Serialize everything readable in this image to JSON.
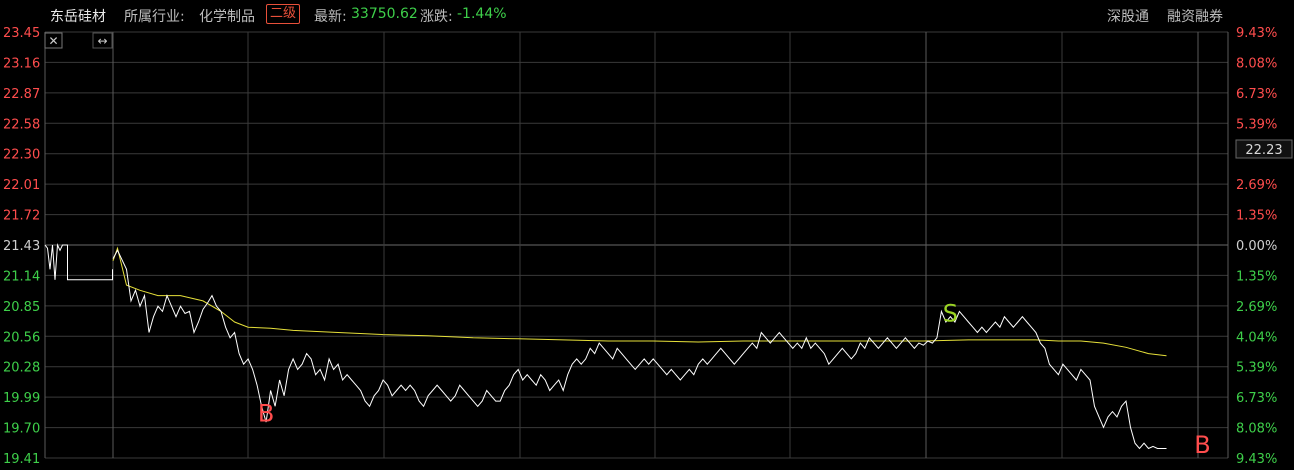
{
  "header": {
    "stock_name": "东岳硅材",
    "industry_label": "所属行业:",
    "industry_name": "化学制品",
    "level_badge": "二级",
    "latest_label": "最新:",
    "latest_value": "33750.62",
    "change_label": "涨跌:",
    "change_value": "-1.44%",
    "link_shenzhen": "深股通",
    "link_margin": "融资融券"
  },
  "controls": {
    "close_glyph": "✕",
    "resize_glyph": "↔"
  },
  "colors": {
    "up": "#ff4d4d",
    "down": "#3ecf4a",
    "neutral": "#cfcfcf",
    "price_line": "#ffffff",
    "avg_line": "#e6e03a",
    "grid": "#3a3a3a"
  },
  "chart_data": {
    "type": "line",
    "y_ticks": [
      "23.45",
      "23.16",
      "22.87",
      "22.58",
      "22.30",
      "22.01",
      "21.72",
      "21.43",
      "21.14",
      "20.85",
      "20.56",
      "20.28",
      "19.99",
      "19.70",
      "19.41"
    ],
    "pct_ticks": [
      "9.43%",
      "8.08%",
      "6.73%",
      "5.39%",
      "4.04%",
      "2.69%",
      "1.35%",
      "0.00%",
      "1.35%",
      "2.69%",
      "4.04%",
      "5.39%",
      "6.73%",
      "8.08%",
      "9.43%"
    ],
    "ylim": [
      19.41,
      23.45
    ],
    "prev_close": 21.43,
    "current_price_label": "22.23",
    "x_range": [
      0,
      241
    ],
    "pre_segment": [
      [
        0,
        21.43
      ],
      [
        1,
        21.4
      ],
      [
        2,
        21.2
      ],
      [
        3,
        21.43
      ],
      [
        4,
        21.1
      ],
      [
        5,
        21.43
      ],
      [
        6,
        21.38
      ],
      [
        7,
        21.43
      ],
      [
        8,
        21.43
      ],
      [
        9,
        21.43
      ],
      [
        9,
        21.1
      ],
      [
        27,
        21.1
      ],
      [
        27,
        21.2
      ]
    ],
    "price": [
      [
        0,
        21.3
      ],
      [
        1,
        21.38
      ],
      [
        3,
        21.2
      ],
      [
        4,
        20.9
      ],
      [
        5,
        21.0
      ],
      [
        6,
        20.85
      ],
      [
        7,
        20.95
      ],
      [
        8,
        20.6
      ],
      [
        9,
        20.75
      ],
      [
        10,
        20.85
      ],
      [
        11,
        20.8
      ],
      [
        12,
        20.95
      ],
      [
        13,
        20.85
      ],
      [
        14,
        20.75
      ],
      [
        15,
        20.85
      ],
      [
        16,
        20.78
      ],
      [
        17,
        20.8
      ],
      [
        18,
        20.6
      ],
      [
        19,
        20.7
      ],
      [
        20,
        20.82
      ],
      [
        21,
        20.88
      ],
      [
        22,
        20.95
      ],
      [
        23,
        20.85
      ],
      [
        24,
        20.8
      ],
      [
        25,
        20.65
      ],
      [
        26,
        20.55
      ],
      [
        27,
        20.6
      ],
      [
        28,
        20.4
      ],
      [
        29,
        20.3
      ],
      [
        30,
        20.35
      ],
      [
        31,
        20.25
      ],
      [
        32,
        20.1
      ],
      [
        33,
        19.9
      ],
      [
        34,
        19.75
      ],
      [
        35,
        20.05
      ],
      [
        36,
        19.9
      ],
      [
        37,
        20.15
      ],
      [
        38,
        20.0
      ],
      [
        39,
        20.25
      ],
      [
        40,
        20.35
      ],
      [
        41,
        20.25
      ],
      [
        42,
        20.3
      ],
      [
        43,
        20.4
      ],
      [
        44,
        20.35
      ],
      [
        45,
        20.2
      ],
      [
        46,
        20.25
      ],
      [
        47,
        20.15
      ],
      [
        48,
        20.35
      ],
      [
        49,
        20.25
      ],
      [
        50,
        20.3
      ],
      [
        51,
        20.15
      ],
      [
        52,
        20.2
      ],
      [
        53,
        20.15
      ],
      [
        54,
        20.1
      ],
      [
        55,
        20.05
      ],
      [
        56,
        19.95
      ],
      [
        57,
        19.9
      ],
      [
        58,
        20.0
      ],
      [
        59,
        20.05
      ],
      [
        60,
        20.15
      ],
      [
        61,
        20.1
      ],
      [
        62,
        20.0
      ],
      [
        63,
        20.05
      ],
      [
        64,
        20.1
      ],
      [
        65,
        20.05
      ],
      [
        66,
        20.1
      ],
      [
        67,
        20.05
      ],
      [
        68,
        19.95
      ],
      [
        69,
        19.9
      ],
      [
        70,
        20.0
      ],
      [
        71,
        20.05
      ],
      [
        72,
        20.1
      ],
      [
        73,
        20.05
      ],
      [
        74,
        20.0
      ],
      [
        75,
        19.95
      ],
      [
        76,
        20.0
      ],
      [
        77,
        20.1
      ],
      [
        78,
        20.05
      ],
      [
        79,
        20.0
      ],
      [
        80,
        19.95
      ],
      [
        81,
        19.9
      ],
      [
        82,
        19.95
      ],
      [
        83,
        20.05
      ],
      [
        84,
        20.0
      ],
      [
        85,
        19.95
      ],
      [
        86,
        19.95
      ],
      [
        87,
        20.05
      ],
      [
        88,
        20.1
      ],
      [
        89,
        20.2
      ],
      [
        90,
        20.25
      ],
      [
        91,
        20.15
      ],
      [
        92,
        20.2
      ],
      [
        93,
        20.15
      ],
      [
        94,
        20.1
      ],
      [
        95,
        20.2
      ],
      [
        96,
        20.15
      ],
      [
        97,
        20.05
      ],
      [
        98,
        20.1
      ],
      [
        99,
        20.15
      ],
      [
        100,
        20.05
      ],
      [
        101,
        20.2
      ],
      [
        102,
        20.3
      ],
      [
        103,
        20.35
      ],
      [
        104,
        20.3
      ],
      [
        105,
        20.35
      ],
      [
        106,
        20.45
      ],
      [
        107,
        20.4
      ],
      [
        108,
        20.5
      ],
      [
        109,
        20.45
      ],
      [
        110,
        20.4
      ],
      [
        111,
        20.35
      ],
      [
        112,
        20.45
      ],
      [
        113,
        20.4
      ],
      [
        114,
        20.35
      ],
      [
        115,
        20.3
      ],
      [
        116,
        20.25
      ],
      [
        117,
        20.3
      ],
      [
        118,
        20.35
      ],
      [
        119,
        20.3
      ],
      [
        120,
        20.35
      ],
      [
        121,
        20.3
      ],
      [
        122,
        20.25
      ],
      [
        123,
        20.2
      ],
      [
        124,
        20.25
      ],
      [
        125,
        20.2
      ],
      [
        126,
        20.15
      ],
      [
        127,
        20.2
      ],
      [
        128,
        20.25
      ],
      [
        129,
        20.2
      ],
      [
        130,
        20.3
      ],
      [
        131,
        20.35
      ],
      [
        132,
        20.3
      ],
      [
        133,
        20.35
      ],
      [
        134,
        20.4
      ],
      [
        135,
        20.45
      ],
      [
        136,
        20.4
      ],
      [
        137,
        20.35
      ],
      [
        138,
        20.3
      ],
      [
        139,
        20.35
      ],
      [
        140,
        20.4
      ],
      [
        141,
        20.45
      ],
      [
        142,
        20.5
      ],
      [
        143,
        20.45
      ],
      [
        144,
        20.6
      ],
      [
        145,
        20.55
      ],
      [
        146,
        20.5
      ],
      [
        147,
        20.55
      ],
      [
        148,
        20.6
      ],
      [
        149,
        20.55
      ],
      [
        150,
        20.5
      ],
      [
        151,
        20.45
      ],
      [
        152,
        20.5
      ],
      [
        153,
        20.45
      ],
      [
        154,
        20.55
      ],
      [
        155,
        20.45
      ],
      [
        156,
        20.5
      ],
      [
        157,
        20.45
      ],
      [
        158,
        20.4
      ],
      [
        159,
        20.3
      ],
      [
        160,
        20.35
      ],
      [
        161,
        20.4
      ],
      [
        162,
        20.45
      ],
      [
        163,
        20.4
      ],
      [
        164,
        20.35
      ],
      [
        165,
        20.4
      ],
      [
        166,
        20.5
      ],
      [
        167,
        20.45
      ],
      [
        168,
        20.55
      ],
      [
        169,
        20.5
      ],
      [
        170,
        20.45
      ],
      [
        171,
        20.5
      ],
      [
        172,
        20.55
      ],
      [
        173,
        20.5
      ],
      [
        174,
        20.45
      ],
      [
        175,
        20.5
      ],
      [
        176,
        20.55
      ],
      [
        177,
        20.5
      ],
      [
        178,
        20.45
      ],
      [
        179,
        20.5
      ],
      [
        180,
        20.48
      ],
      [
        181,
        20.52
      ],
      [
        182,
        20.5
      ],
      [
        183,
        20.55
      ],
      [
        184,
        20.8
      ],
      [
        185,
        20.7
      ],
      [
        186,
        20.75
      ],
      [
        187,
        20.7
      ],
      [
        188,
        20.8
      ],
      [
        189,
        20.75
      ],
      [
        190,
        20.7
      ],
      [
        191,
        20.65
      ],
      [
        192,
        20.6
      ],
      [
        193,
        20.65
      ],
      [
        194,
        20.6
      ],
      [
        195,
        20.65
      ],
      [
        196,
        20.7
      ],
      [
        197,
        20.65
      ],
      [
        198,
        20.75
      ],
      [
        199,
        20.7
      ],
      [
        200,
        20.65
      ],
      [
        201,
        20.7
      ],
      [
        202,
        20.75
      ],
      [
        203,
        20.7
      ],
      [
        204,
        20.65
      ],
      [
        205,
        20.6
      ],
      [
        206,
        20.5
      ],
      [
        207,
        20.45
      ],
      [
        208,
        20.3
      ],
      [
        209,
        20.25
      ],
      [
        210,
        20.2
      ],
      [
        211,
        20.3
      ],
      [
        212,
        20.25
      ],
      [
        213,
        20.2
      ],
      [
        214,
        20.15
      ],
      [
        215,
        20.25
      ],
      [
        216,
        20.2
      ],
      [
        217,
        20.15
      ],
      [
        218,
        19.9
      ],
      [
        219,
        19.8
      ],
      [
        220,
        19.7
      ],
      [
        221,
        19.8
      ],
      [
        222,
        19.85
      ],
      [
        223,
        19.8
      ],
      [
        224,
        19.9
      ],
      [
        225,
        19.95
      ],
      [
        226,
        19.7
      ],
      [
        227,
        19.55
      ],
      [
        228,
        19.5
      ],
      [
        229,
        19.55
      ],
      [
        230,
        19.5
      ],
      [
        231,
        19.52
      ],
      [
        232,
        19.5
      ],
      [
        233,
        19.5
      ],
      [
        234,
        19.5
      ]
    ],
    "avg": [
      [
        0,
        21.28
      ],
      [
        1,
        21.4
      ],
      [
        3,
        21.05
      ],
      [
        6,
        21.0
      ],
      [
        10,
        20.95
      ],
      [
        15,
        20.95
      ],
      [
        20,
        20.9
      ],
      [
        24,
        20.8
      ],
      [
        27,
        20.7
      ],
      [
        30,
        20.65
      ],
      [
        35,
        20.64
      ],
      [
        40,
        20.62
      ],
      [
        50,
        20.6
      ],
      [
        60,
        20.58
      ],
      [
        70,
        20.57
      ],
      [
        80,
        20.55
      ],
      [
        90,
        20.54
      ],
      [
        100,
        20.53
      ],
      [
        110,
        20.52
      ],
      [
        120,
        20.52
      ],
      [
        130,
        20.51
      ],
      [
        140,
        20.52
      ],
      [
        150,
        20.52
      ],
      [
        160,
        20.52
      ],
      [
        170,
        20.52
      ],
      [
        180,
        20.52
      ],
      [
        190,
        20.53
      ],
      [
        200,
        20.53
      ],
      [
        205,
        20.53
      ],
      [
        210,
        20.52
      ],
      [
        215,
        20.52
      ],
      [
        220,
        20.5
      ],
      [
        225,
        20.46
      ],
      [
        230,
        20.4
      ],
      [
        234,
        20.38
      ]
    ],
    "markers": [
      {
        "label": "B",
        "x": 34,
        "y": 19.85,
        "color": "#ff4d4d"
      },
      {
        "label": "S",
        "x": 186,
        "y": 20.8,
        "color": "#9bd424"
      },
      {
        "label": "B",
        "x": 242,
        "y": 19.55,
        "color": "#ff4d4d"
      }
    ]
  }
}
